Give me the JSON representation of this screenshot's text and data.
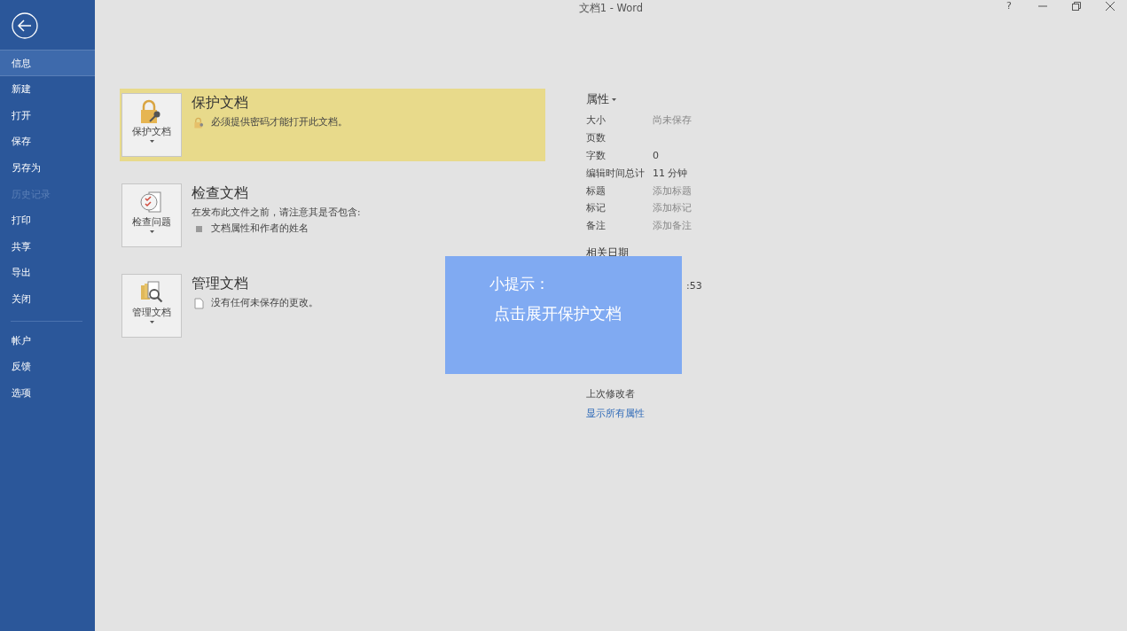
{
  "window": {
    "title": "文档1  -  Word",
    "help": "?"
  },
  "sidebar": {
    "items": [
      {
        "label": "信息",
        "selected": true,
        "disabled": false
      },
      {
        "label": "新建",
        "selected": false,
        "disabled": false
      },
      {
        "label": "打开",
        "selected": false,
        "disabled": false
      },
      {
        "label": "保存",
        "selected": false,
        "disabled": false
      },
      {
        "label": "另存为",
        "selected": false,
        "disabled": false
      },
      {
        "label": "历史记录",
        "selected": false,
        "disabled": true
      },
      {
        "label": "打印",
        "selected": false,
        "disabled": false
      },
      {
        "label": "共享",
        "selected": false,
        "disabled": false
      },
      {
        "label": "导出",
        "selected": false,
        "disabled": false
      },
      {
        "label": "关闭",
        "selected": false,
        "disabled": false
      }
    ],
    "footer_items": [
      {
        "label": "帐户",
        "selected": false,
        "disabled": false
      },
      {
        "label": "反馈",
        "selected": false,
        "disabled": false
      },
      {
        "label": "选项",
        "selected": false,
        "disabled": false
      }
    ]
  },
  "sections": [
    {
      "title": "保护文档",
      "button": "保护文档",
      "kind": "lock",
      "highlighted": true,
      "lines": [
        {
          "kind": "note",
          "text": "必须提供密码才能打开此文档。"
        }
      ]
    },
    {
      "title": "检查文档",
      "button": "检查问题",
      "kind": "inspect",
      "highlighted": false,
      "lines": [
        {
          "kind": "text",
          "text": "在发布此文件之前，请注意其是否包含:"
        },
        {
          "kind": "bullet",
          "text": "文档属性和作者的姓名"
        }
      ]
    },
    {
      "title": "管理文档",
      "button": "管理文档",
      "kind": "manage",
      "highlighted": false,
      "lines": [
        {
          "kind": "page",
          "text": "没有任何未保存的更改。"
        }
      ]
    }
  ],
  "properties": {
    "heading": "属性",
    "rows": [
      {
        "label": "大小",
        "value": "尚未保存",
        "muted": true
      },
      {
        "label": "页数"
      },
      {
        "label": "字数",
        "value": "0",
        "muted": false
      },
      {
        "label": "编辑时间总计",
        "value": "11 分钟",
        "muted": false
      },
      {
        "label": "标题",
        "value": "添加标题",
        "muted": true
      },
      {
        "label": "标记",
        "value": "添加标记",
        "muted": true
      },
      {
        "label": "备注",
        "value": "添加备注",
        "muted": true
      }
    ],
    "related_dates": {
      "heading": "相关日期",
      "value_fragment": ":53"
    },
    "last_modified_by": "上次修改者",
    "link": "显示所有属性"
  },
  "tip": {
    "title": "小提示：",
    "text": "点击展开保护文档"
  }
}
